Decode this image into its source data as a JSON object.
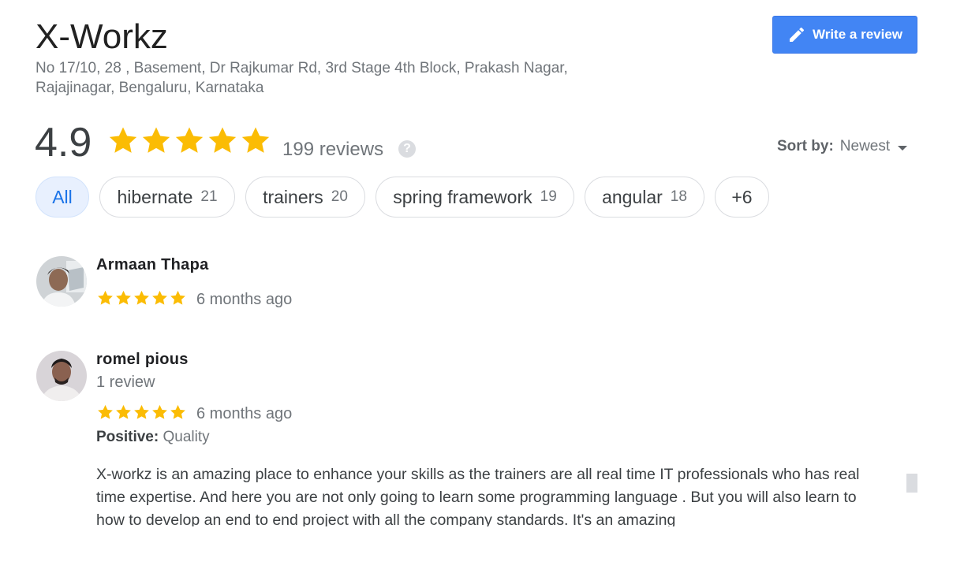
{
  "business": {
    "name": "X-Workz",
    "address_line1": "No 17/10, 28 , Basement, Dr Rajkumar Rd, 3rd Stage 4th Block, Prakash Nagar,",
    "address_line2": "Rajajinagar, Bengaluru, Karnataka"
  },
  "write_review": {
    "label": "Write a review",
    "icon": "pencil-icon"
  },
  "summary": {
    "rating": "4.9",
    "stars": 5,
    "review_count": "199 reviews",
    "help_glyph": "?"
  },
  "sort": {
    "label": "Sort by:",
    "value": "Newest"
  },
  "chips": [
    {
      "label": "All",
      "count": ""
    },
    {
      "label": "hibernate",
      "count": "21"
    },
    {
      "label": "trainers",
      "count": "20"
    },
    {
      "label": "spring framework",
      "count": "19"
    },
    {
      "label": "angular",
      "count": "18"
    },
    {
      "label": "+6",
      "count": ""
    }
  ],
  "reviews": [
    {
      "name": "Armaan Thapa",
      "meta": "",
      "stars": 5,
      "time": "6 months ago"
    },
    {
      "name": "romel pious",
      "meta": "1 review",
      "stars": 5,
      "time": "6 months ago",
      "positive_label": "Positive:",
      "positive_value": "Quality",
      "text": "X-workz is an amazing place to enhance your skills as the trainers are all real time IT professionals who has real time expertise. And here you are not only going to learn some programming language . But you will also learn to how to develop an end to end project with all the company standards. It's an amazing"
    }
  ],
  "colors": {
    "star": "#fbbc04",
    "accent": "#4285f4",
    "chip_active_bg": "#e8f0fe",
    "chip_active_text": "#1a73e8"
  }
}
